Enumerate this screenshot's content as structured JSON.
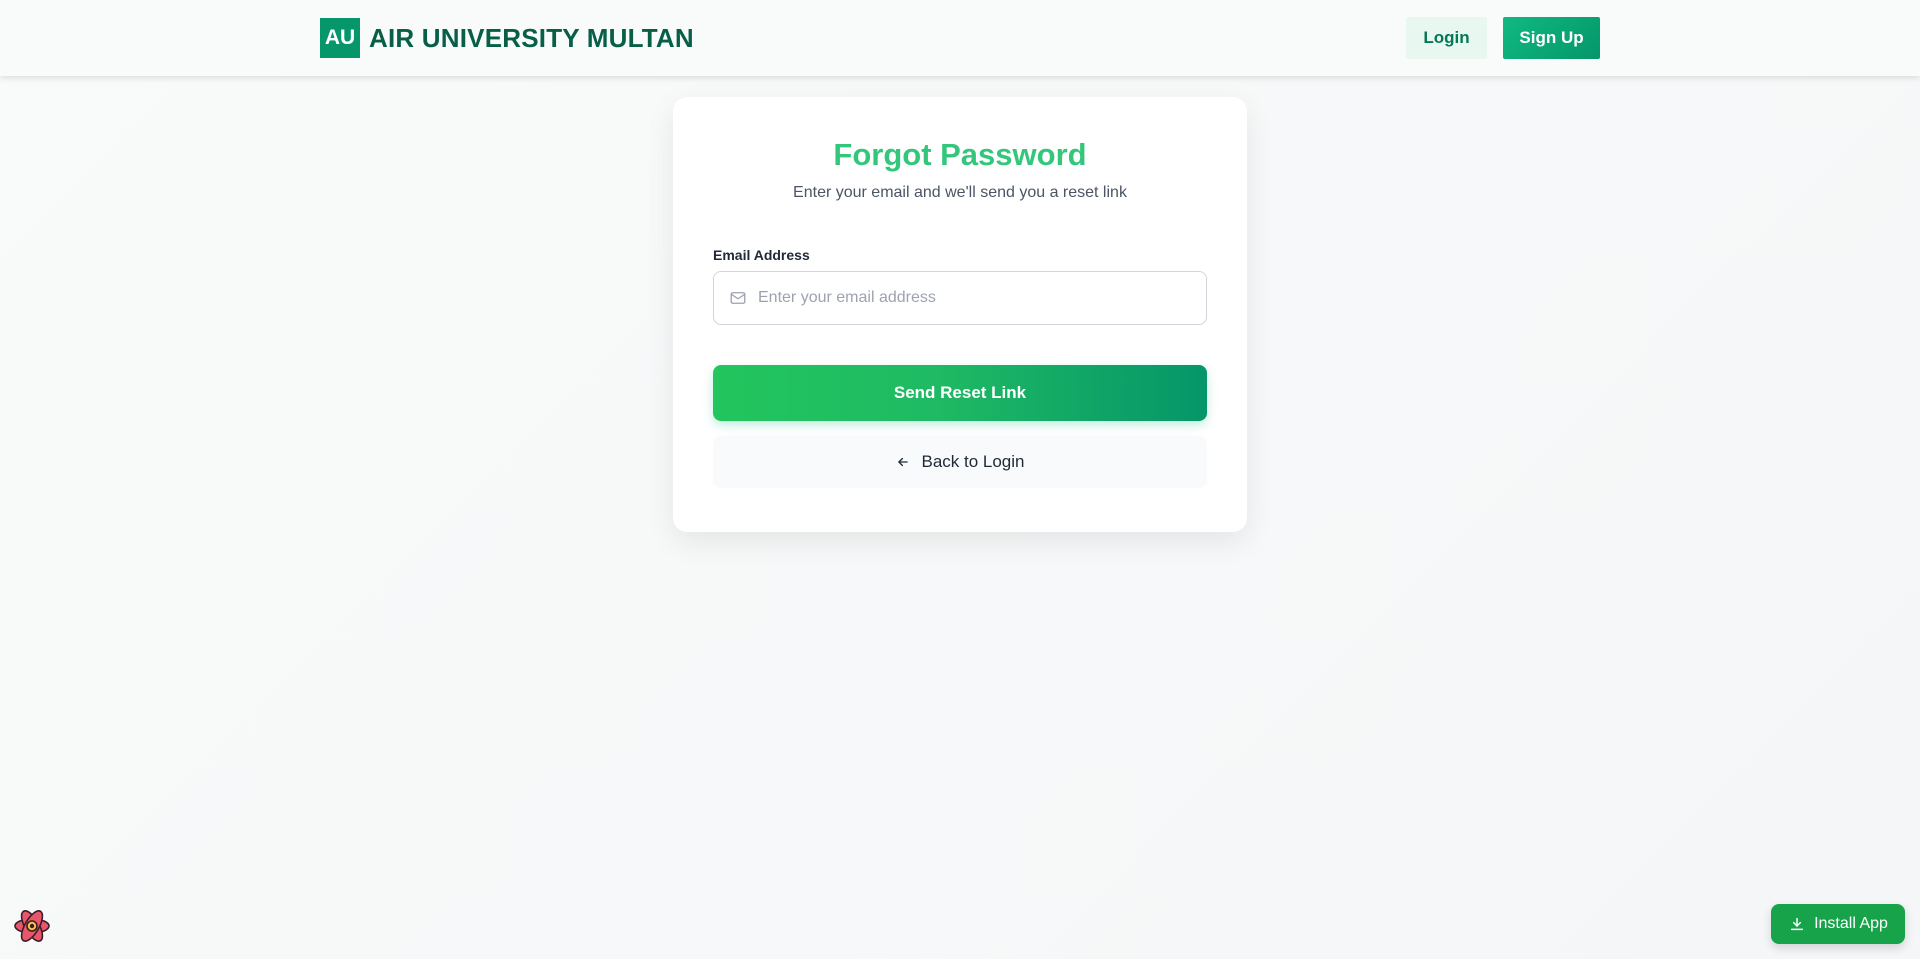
{
  "header": {
    "logo_text": "AU",
    "brand_name": "AIR UNIVERSITY MULTAN",
    "login_label": "Login",
    "signup_label": "Sign Up"
  },
  "form": {
    "title": "Forgot Password",
    "subtitle": "Enter your email and we'll send you a reset link",
    "email_label": "Email Address",
    "email_placeholder": "Enter your email address",
    "email_value": "",
    "email_icon": "mail-icon",
    "submit_label": "Send Reset Link",
    "back_label": "Back to Login",
    "back_icon": "arrow-left-icon"
  },
  "floating": {
    "install_label": "Install App",
    "install_icon": "download-icon",
    "dev_badge_icon": "react-icon"
  },
  "colors": {
    "brand_green": "#059669",
    "brand_dark_green": "#065f46",
    "title_green": "#34c77b",
    "button_gradient_start": "#22c55e",
    "button_gradient_end": "#059669"
  }
}
